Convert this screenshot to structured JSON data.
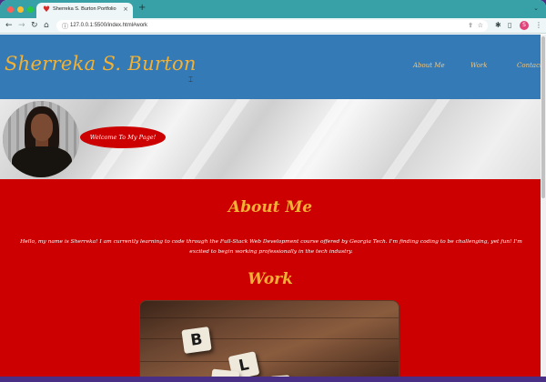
{
  "browser": {
    "tab_title": "Sherreka S. Burton Portfolio",
    "tab_close": "×",
    "new_tab": "+",
    "url": "127.0.0.1:5500/index.html#work",
    "profile_initial": "S",
    "accent_color": "#38a0a7"
  },
  "site": {
    "brand": "Sherreka S. Burton",
    "nav": [
      "About Me",
      "Work",
      "Contact"
    ],
    "welcome_button": "Welcome To My Page!",
    "about": {
      "title": "About Me",
      "text": "Hello, my name is Sherreka! I am currently learning to code through the Full-Stack Web Development course offered by Georgia Tech. I'm finding coding to be challenging, yet fun! I'm excited to begin working professionally in the tech industry."
    },
    "work": {
      "title": "Work",
      "tiles": [
        "B",
        "L",
        "",
        ""
      ]
    },
    "colors": {
      "header_bg": "#337ab7",
      "page_bg": "#cc0000",
      "heading": "#f2b134"
    }
  }
}
